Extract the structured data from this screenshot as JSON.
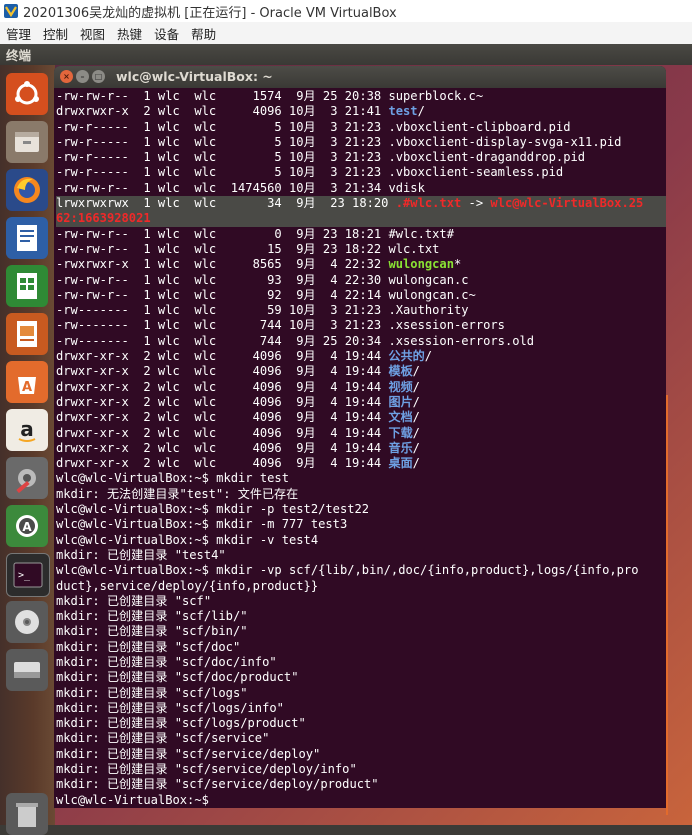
{
  "vbox": {
    "title": "20201306吴龙灿的虚拟机 [正在运行] - Oracle VM VirtualBox",
    "menu": [
      "管理",
      "控制",
      "视图",
      "热键",
      "设备",
      "帮助"
    ]
  },
  "ubuntu": {
    "topbar_title": "终端"
  },
  "terminal": {
    "title": "wlc@wlc-VirtualBox: ~",
    "ls_rows": [
      {
        "perm": "-rw-rw-r--",
        "n": "1",
        "u": "wlc",
        "g": "wlc",
        "size": "1574",
        "mon": "9月",
        "day": "25",
        "time": "20:38",
        "name": "superblock.c~",
        "type": "file"
      },
      {
        "perm": "drwxrwxr-x",
        "n": "2",
        "u": "wlc",
        "g": "wlc",
        "size": "4096",
        "mon": "10月",
        "day": "3",
        "time": "21:41",
        "name": "test",
        "suffix": "/",
        "type": "dir"
      },
      {
        "perm": "-rw-r-----",
        "n": "1",
        "u": "wlc",
        "g": "wlc",
        "size": "5",
        "mon": "10月",
        "day": "3",
        "time": "21:23",
        "name": ".vboxclient-clipboard.pid",
        "type": "file"
      },
      {
        "perm": "-rw-r-----",
        "n": "1",
        "u": "wlc",
        "g": "wlc",
        "size": "5",
        "mon": "10月",
        "day": "3",
        "time": "21:23",
        "name": ".vboxclient-display-svga-x11.pid",
        "type": "file"
      },
      {
        "perm": "-rw-r-----",
        "n": "1",
        "u": "wlc",
        "g": "wlc",
        "size": "5",
        "mon": "10月",
        "day": "3",
        "time": "21:23",
        "name": ".vboxclient-draganddrop.pid",
        "type": "file"
      },
      {
        "perm": "-rw-r-----",
        "n": "1",
        "u": "wlc",
        "g": "wlc",
        "size": "5",
        "mon": "10月",
        "day": "3",
        "time": "21:23",
        "name": ".vboxclient-seamless.pid",
        "type": "file"
      },
      {
        "perm": "-rw-rw-r--",
        "n": "1",
        "u": "wlc",
        "g": "wlc",
        "size": "1474560",
        "mon": "10月",
        "day": "3",
        "time": "21:34",
        "name": "vdisk",
        "type": "file"
      }
    ],
    "link_row": {
      "prefix": "lrwxrwxrwx  1 wlc  wlc       34  9月  23 18:20 ",
      "name": ".#wlc.txt",
      "arrow": " -> ",
      "target_a": "wlc@wlc-VirtualBox.25",
      "target_b": "62:1663928021"
    },
    "ls_rows2": [
      {
        "perm": "-rw-rw-r--",
        "n": "1",
        "u": "wlc",
        "g": "wlc",
        "size": "0",
        "mon": "9月",
        "day": "23",
        "time": "18:21",
        "name": "#wlc.txt#",
        "type": "file"
      },
      {
        "perm": "-rw-rw-r--",
        "n": "1",
        "u": "wlc",
        "g": "wlc",
        "size": "15",
        "mon": "9月",
        "day": "23",
        "time": "18:22",
        "name": "wlc.txt",
        "type": "file"
      },
      {
        "perm": "-rwxrwxr-x",
        "n": "1",
        "u": "wlc",
        "g": "wlc",
        "size": "8565",
        "mon": "9月",
        "day": "4",
        "time": "22:32",
        "name": "wulongcan",
        "suffix": "*",
        "type": "exe"
      },
      {
        "perm": "-rw-rw-r--",
        "n": "1",
        "u": "wlc",
        "g": "wlc",
        "size": "93",
        "mon": "9月",
        "day": "4",
        "time": "22:30",
        "name": "wulongcan.c",
        "type": "file"
      },
      {
        "perm": "-rw-rw-r--",
        "n": "1",
        "u": "wlc",
        "g": "wlc",
        "size": "92",
        "mon": "9月",
        "day": "4",
        "time": "22:14",
        "name": "wulongcan.c~",
        "type": "file"
      },
      {
        "perm": "-rw-------",
        "n": "1",
        "u": "wlc",
        "g": "wlc",
        "size": "59",
        "mon": "10月",
        "day": "3",
        "time": "21:23",
        "name": ".Xauthority",
        "type": "file"
      },
      {
        "perm": "-rw-------",
        "n": "1",
        "u": "wlc",
        "g": "wlc",
        "size": "744",
        "mon": "10月",
        "day": "3",
        "time": "21:23",
        "name": ".xsession-errors",
        "type": "file"
      },
      {
        "perm": "-rw-------",
        "n": "1",
        "u": "wlc",
        "g": "wlc",
        "size": "744",
        "mon": "9月",
        "day": "25",
        "time": "20:34",
        "name": ".xsession-errors.old",
        "type": "file"
      },
      {
        "perm": "drwxr-xr-x",
        "n": "2",
        "u": "wlc",
        "g": "wlc",
        "size": "4096",
        "mon": "9月",
        "day": "4",
        "time": "19:44",
        "name": "公共的",
        "suffix": "/",
        "type": "dir"
      },
      {
        "perm": "drwxr-xr-x",
        "n": "2",
        "u": "wlc",
        "g": "wlc",
        "size": "4096",
        "mon": "9月",
        "day": "4",
        "time": "19:44",
        "name": "模板",
        "suffix": "/",
        "type": "dir"
      },
      {
        "perm": "drwxr-xr-x",
        "n": "2",
        "u": "wlc",
        "g": "wlc",
        "size": "4096",
        "mon": "9月",
        "day": "4",
        "time": "19:44",
        "name": "视频",
        "suffix": "/",
        "type": "dir"
      },
      {
        "perm": "drwxr-xr-x",
        "n": "2",
        "u": "wlc",
        "g": "wlc",
        "size": "4096",
        "mon": "9月",
        "day": "4",
        "time": "19:44",
        "name": "图片",
        "suffix": "/",
        "type": "dir"
      },
      {
        "perm": "drwxr-xr-x",
        "n": "2",
        "u": "wlc",
        "g": "wlc",
        "size": "4096",
        "mon": "9月",
        "day": "4",
        "time": "19:44",
        "name": "文档",
        "suffix": "/",
        "type": "dir"
      },
      {
        "perm": "drwxr-xr-x",
        "n": "2",
        "u": "wlc",
        "g": "wlc",
        "size": "4096",
        "mon": "9月",
        "day": "4",
        "time": "19:44",
        "name": "下载",
        "suffix": "/",
        "type": "dir"
      },
      {
        "perm": "drwxr-xr-x",
        "n": "2",
        "u": "wlc",
        "g": "wlc",
        "size": "4096",
        "mon": "9月",
        "day": "4",
        "time": "19:44",
        "name": "音乐",
        "suffix": "/",
        "type": "dir"
      },
      {
        "perm": "drwxr-xr-x",
        "n": "2",
        "u": "wlc",
        "g": "wlc",
        "size": "4096",
        "mon": "9月",
        "day": "4",
        "time": "19:44",
        "name": "桌面",
        "suffix": "/",
        "type": "dir"
      }
    ],
    "output_lines": [
      "wlc@wlc-VirtualBox:~$ mkdir test",
      "mkdir: 无法创建目录\"test\": 文件已存在",
      "wlc@wlc-VirtualBox:~$ mkdir -p test2/test22",
      "wlc@wlc-VirtualBox:~$ mkdir -m 777 test3",
      "wlc@wlc-VirtualBox:~$ mkdir -v test4",
      "mkdir: 已创建目录 \"test4\"",
      "wlc@wlc-VirtualBox:~$ mkdir -vp scf/{lib/,bin/,doc/{info,product},logs/{info,pro",
      "duct},service/deploy/{info,product}}",
      "mkdir: 已创建目录 \"scf\"",
      "mkdir: 已创建目录 \"scf/lib/\"",
      "mkdir: 已创建目录 \"scf/bin/\"",
      "mkdir: 已创建目录 \"scf/doc\"",
      "mkdir: 已创建目录 \"scf/doc/info\"",
      "mkdir: 已创建目录 \"scf/doc/product\"",
      "mkdir: 已创建目录 \"scf/logs\"",
      "mkdir: 已创建目录 \"scf/logs/info\"",
      "mkdir: 已创建目录 \"scf/logs/product\"",
      "mkdir: 已创建目录 \"scf/service\"",
      "mkdir: 已创建目录 \"scf/service/deploy\"",
      "mkdir: 已创建目录 \"scf/service/deploy/info\"",
      "mkdir: 已创建目录 \"scf/service/deploy/product\"",
      "wlc@wlc-VirtualBox:~$ "
    ]
  },
  "launcher": {
    "items": [
      "ubuntu-dash-icon",
      "files-icon",
      "firefox-icon",
      "writer-icon",
      "calc-icon",
      "impress-icon",
      "software-center-icon",
      "amazon-icon",
      "system-settings-icon",
      "software-updater-icon",
      "terminal-icon",
      "dvd-icon",
      "drive-icon",
      "trash-icon"
    ]
  },
  "colors": {
    "dir": "#6ea0e3",
    "exe": "#8ae234",
    "link": "#ef2929",
    "term_bg": "#300a24"
  }
}
